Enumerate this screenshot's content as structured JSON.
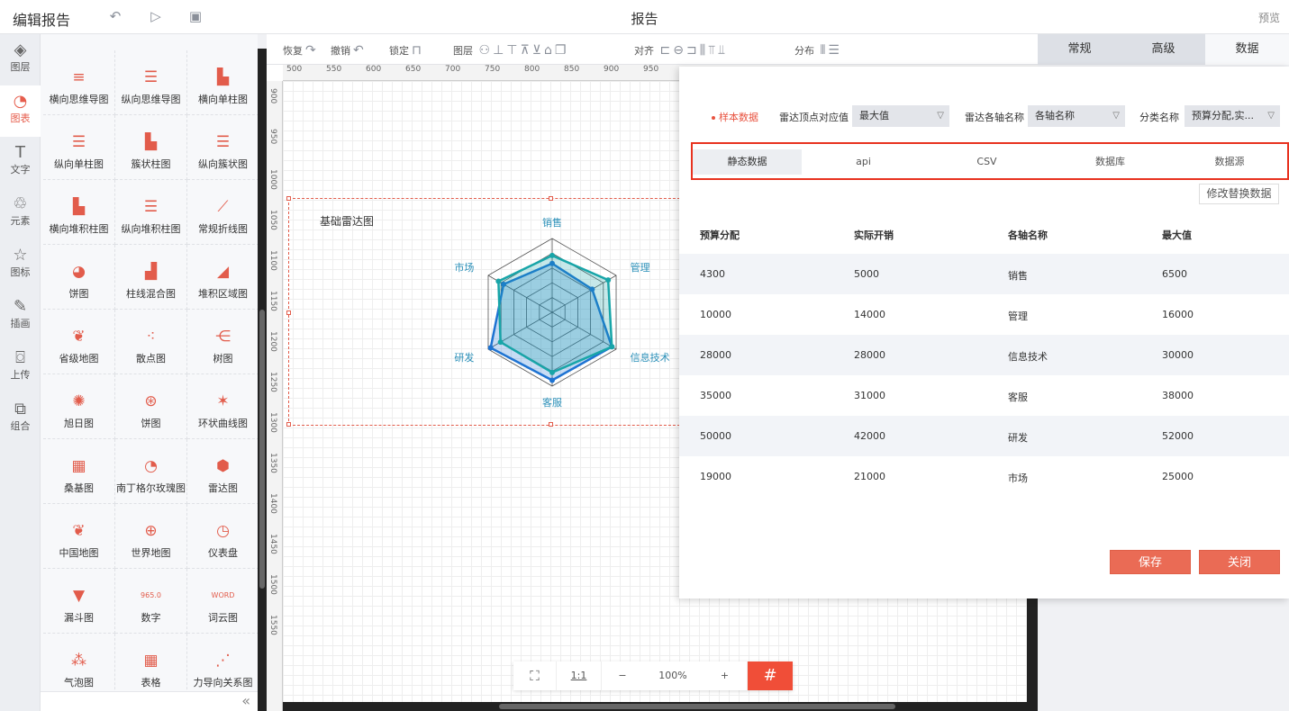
{
  "topbar": {
    "title": "编辑报告",
    "center_title": "报告",
    "preview": "预览",
    "icons": [
      "undo-icon",
      "play-icon",
      "save-icon"
    ]
  },
  "leftnav": [
    {
      "label": "图层",
      "icon": "layers-icon",
      "active": false
    },
    {
      "label": "图表",
      "icon": "chart-icon",
      "active": true
    },
    {
      "label": "文字",
      "icon": "text-icon",
      "active": false
    },
    {
      "label": "元素",
      "icon": "shapes-icon",
      "active": false
    },
    {
      "label": "图标",
      "icon": "star-icon",
      "active": false
    },
    {
      "label": "插画",
      "icon": "palette-icon",
      "active": false
    },
    {
      "label": "上传",
      "icon": "upload-image-icon",
      "active": false
    },
    {
      "label": "组合",
      "icon": "group-icon",
      "active": false
    }
  ],
  "palette": [
    {
      "label": "横向思维导图",
      "glyph": "≡"
    },
    {
      "label": "纵向思维导图",
      "glyph": "☰"
    },
    {
      "label": "横向单柱图",
      "glyph": "▙"
    },
    {
      "label": "纵向单柱图",
      "glyph": "☰"
    },
    {
      "label": "簇状柱图",
      "glyph": "▙"
    },
    {
      "label": "纵向簇状图",
      "glyph": "☰"
    },
    {
      "label": "横向堆积柱图",
      "glyph": "▙"
    },
    {
      "label": "纵向堆积柱图",
      "glyph": "☰"
    },
    {
      "label": "常规折线图",
      "glyph": "⟋"
    },
    {
      "label": "饼图",
      "glyph": "◕"
    },
    {
      "label": "柱线混合图",
      "glyph": "▟"
    },
    {
      "label": "堆积区域图",
      "glyph": "◢"
    },
    {
      "label": "省级地图",
      "glyph": "❦"
    },
    {
      "label": "散点图",
      "glyph": "⁖"
    },
    {
      "label": "树图",
      "glyph": "⋲"
    },
    {
      "label": "旭日图",
      "glyph": "✺"
    },
    {
      "label": "饼图",
      "glyph": "⊛"
    },
    {
      "label": "环状曲线图",
      "glyph": "✶"
    },
    {
      "label": "桑基图",
      "glyph": "▦"
    },
    {
      "label": "南丁格尔玫瑰图",
      "glyph": "◔"
    },
    {
      "label": "雷达图",
      "glyph": "⬢"
    },
    {
      "label": "中国地图",
      "glyph": "❦"
    },
    {
      "label": "世界地图",
      "glyph": "⊕"
    },
    {
      "label": "仪表盘",
      "glyph": "◷"
    },
    {
      "label": "漏斗图",
      "glyph": "▼"
    },
    {
      "label": "数字",
      "glyph": "965.0"
    },
    {
      "label": "词云图",
      "glyph": "WORD"
    },
    {
      "label": "气泡图",
      "glyph": "⁂"
    },
    {
      "label": "表格",
      "glyph": "▦"
    },
    {
      "label": "力导向关系图",
      "glyph": "⋰"
    }
  ],
  "palette_scroll": "«",
  "toolbar": {
    "redo": "恢复",
    "undo": "撤销",
    "lock": "锁定",
    "layer": "图层",
    "align": "对齐",
    "distribute": "分布"
  },
  "ruler": {
    "top": [
      "500",
      "550",
      "600",
      "650",
      "700",
      "750",
      "800",
      "850",
      "900",
      "950"
    ],
    "left": [
      "900",
      "950",
      "1000",
      "1050",
      "1100",
      "1150",
      "1200",
      "1250",
      "1300",
      "1350",
      "1400",
      "1450",
      "1500",
      "1550"
    ]
  },
  "widget": {
    "title": "基础雷达图"
  },
  "radar": {
    "axes": [
      "销售",
      "管理",
      "信息技术",
      "客服",
      "研发",
      "市场"
    ],
    "max": [
      6500,
      16000,
      30000,
      38000,
      52000,
      25000
    ],
    "series": [
      {
        "values": [
          4300,
          10000,
          28000,
          35000,
          50000,
          19000
        ],
        "color": "#1e73d2"
      },
      {
        "values": [
          5000,
          14000,
          28000,
          31000,
          42000,
          21000
        ],
        "color": "#18a5a8"
      }
    ],
    "label_color": "#2a8fb8"
  },
  "zoom": {
    "fit_icon": "fit-screen-icon",
    "ratio": "1:1",
    "minus": "−",
    "level": "100%",
    "plus": "+",
    "grid_icon": "grid-icon"
  },
  "right_tabs": [
    "常规",
    "高级",
    "数据"
  ],
  "data_modal": {
    "sample_label": "样本数据",
    "field1_label": "雷达顶点对应值",
    "field1_value": "最大值",
    "field2_label": "雷达各轴名称",
    "field2_value": "各轴名称",
    "field3_label": "分类名称",
    "field3_value": "预算分配,实...",
    "source_tabs": [
      "静态数据",
      "api",
      "CSV",
      "数据库",
      "数据源"
    ],
    "modify_button": "修改替换数据",
    "headers": [
      "预算分配",
      "实际开销",
      "各轴名称",
      "最大值"
    ],
    "rows": [
      [
        "4300",
        "5000",
        "销售",
        "6500"
      ],
      [
        "10000",
        "14000",
        "管理",
        "16000"
      ],
      [
        "28000",
        "28000",
        "信息技术",
        "30000"
      ],
      [
        "35000",
        "31000",
        "客服",
        "38000"
      ],
      [
        "50000",
        "42000",
        "研发",
        "52000"
      ],
      [
        "19000",
        "21000",
        "市场",
        "25000"
      ]
    ],
    "save_label": "保存",
    "close_label": "关闭"
  }
}
